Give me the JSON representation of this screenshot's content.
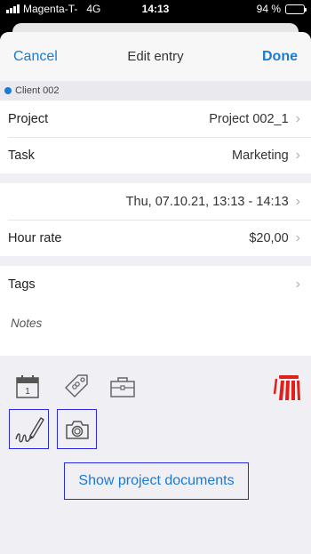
{
  "status_bar": {
    "carrier": "Magenta-T-",
    "network": "4G",
    "time": "14:13",
    "battery_percent": "94 %",
    "battery_level": 0.94
  },
  "nav": {
    "cancel_label": "Cancel",
    "title": "Edit entry",
    "done_label": "Done"
  },
  "client": {
    "name": "Client 002",
    "dot_color": "#1a7bd6"
  },
  "fields": {
    "project": {
      "label": "Project",
      "value": "Project 002_1"
    },
    "task": {
      "label": "Task",
      "value": "Marketing"
    },
    "time_range": {
      "value": "Thu, 07.10.21, 13:13 - 14:13"
    },
    "hour_rate": {
      "label": "Hour rate",
      "value": "$20,00"
    },
    "tags": {
      "label": "Tags"
    },
    "notes": {
      "placeholder": "Notes"
    }
  },
  "toolbar": {
    "icons": [
      "calendar-icon",
      "tag-icon",
      "briefcase-icon",
      "trash-icon",
      "signature-icon",
      "camera-icon"
    ],
    "calendar_day": "1",
    "delete_color": "#e0201a",
    "accent_border": "#2b2be0"
  },
  "documents_button_label": "Show project documents",
  "colors": {
    "accent": "#1a7bd6",
    "background": "#efeff4"
  }
}
